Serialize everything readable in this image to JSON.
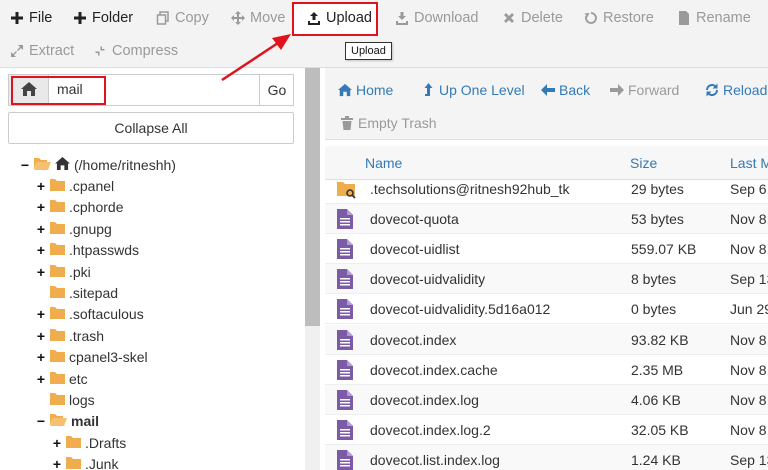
{
  "toolbar": {
    "file": "File",
    "folder": "Folder",
    "copy": "Copy",
    "move": "Move",
    "upload": "Upload",
    "download": "Download",
    "delete": "Delete",
    "restore": "Restore",
    "rename": "Rename",
    "extract": "Extract",
    "compress": "Compress",
    "tooltip": "Upload"
  },
  "left": {
    "path_value": "mail",
    "go": "Go",
    "collapse_all": "Collapse All",
    "tree": [
      {
        "label": "(/home/ritneshh)",
        "toggle": "−"
      },
      {
        "label": ".cpanel",
        "toggle": "+"
      },
      {
        "label": ".cphorde",
        "toggle": "+"
      },
      {
        "label": ".gnupg",
        "toggle": "+"
      },
      {
        "label": ".htpasswds",
        "toggle": "+"
      },
      {
        "label": ".pki",
        "toggle": "+"
      },
      {
        "label": ".sitepad",
        "toggle": ""
      },
      {
        "label": ".softaculous",
        "toggle": "+"
      },
      {
        "label": ".trash",
        "toggle": "+"
      },
      {
        "label": "cpanel3-skel",
        "toggle": "+"
      },
      {
        "label": "etc",
        "toggle": "+"
      },
      {
        "label": "logs",
        "toggle": ""
      },
      {
        "label": "mail",
        "toggle": "−"
      },
      {
        "label": ".Drafts",
        "toggle": "+"
      },
      {
        "label": ".Junk",
        "toggle": "+"
      }
    ]
  },
  "nav": {
    "home": "Home",
    "up_one_level": "Up One Level",
    "back": "Back",
    "forward": "Forward",
    "reload": "Reload",
    "empty_trash": "Empty Trash"
  },
  "table": {
    "headers": {
      "name": "Name",
      "size": "Size",
      "last_modified": "Last M"
    },
    "rows": [
      {
        "name": ".techsolutions@ritnesh92hub_tk",
        "size": "29 bytes",
        "date": "Sep 6,",
        "type": "link-folder"
      },
      {
        "name": "dovecot-quota",
        "size": "53 bytes",
        "date": "Nov 8,",
        "type": "file"
      },
      {
        "name": "dovecot-uidlist",
        "size": "559.07 KB",
        "date": "Nov 8,",
        "type": "file"
      },
      {
        "name": "dovecot-uidvalidity",
        "size": "8 bytes",
        "date": "Sep 13",
        "type": "file"
      },
      {
        "name": "dovecot-uidvalidity.5d16a012",
        "size": "0 bytes",
        "date": "Jun 29",
        "type": "file"
      },
      {
        "name": "dovecot.index",
        "size": "93.82 KB",
        "date": "Nov 8,",
        "type": "file"
      },
      {
        "name": "dovecot.index.cache",
        "size": "2.35 MB",
        "date": "Nov 8,",
        "type": "file"
      },
      {
        "name": "dovecot.index.log",
        "size": "4.06 KB",
        "date": "Nov 8,",
        "type": "file"
      },
      {
        "name": "dovecot.index.log.2",
        "size": "32.05 KB",
        "date": "Nov 8,",
        "type": "file"
      },
      {
        "name": "dovecot.list.index.log",
        "size": "1.24 KB",
        "date": "Sep 13",
        "type": "file"
      }
    ]
  },
  "colors": {
    "highlight": "#e0121b",
    "link": "#337ab7",
    "folder": "#f0ad4e",
    "file_icon": "#7b5aa6"
  }
}
